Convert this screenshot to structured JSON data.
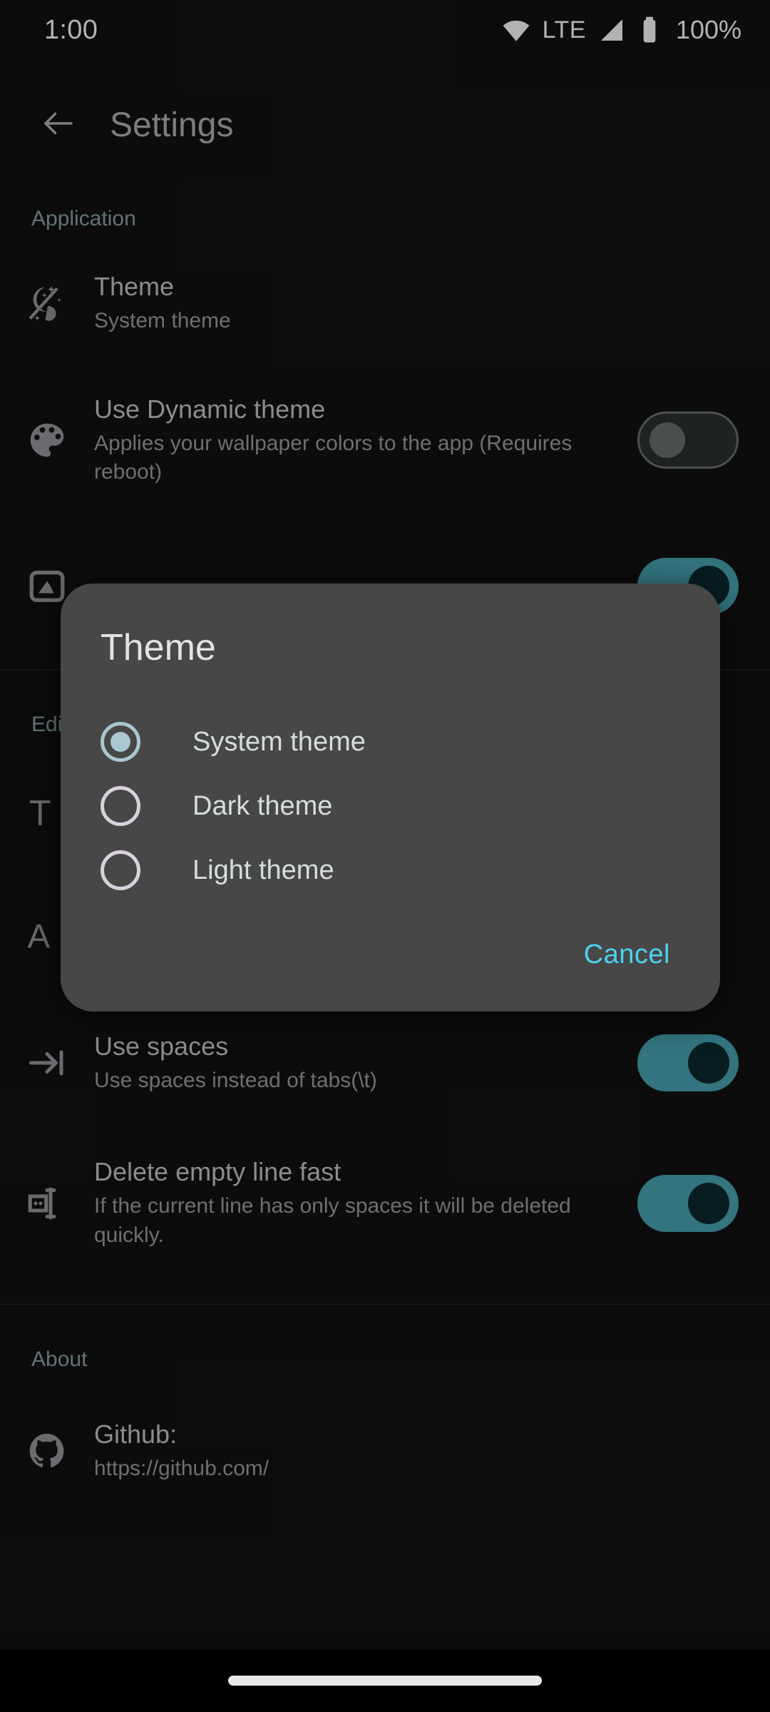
{
  "statusbar": {
    "time": "1:00",
    "network_label": "LTE",
    "battery_percent": "100%",
    "wifi_icon": "wifi-icon",
    "signal_icon": "cell-signal-icon",
    "battery_icon": "battery-full-icon"
  },
  "appbar": {
    "back_icon": "arrow-back-icon",
    "title": "Settings"
  },
  "sections": {
    "application": "Application",
    "editor": "Editor",
    "about": "About"
  },
  "prefs": {
    "theme": {
      "icon": "night-mode-icon",
      "title": "Theme",
      "summary": "System theme"
    },
    "dynamic_theme": {
      "icon": "palette-icon",
      "title": "Use Dynamic theme",
      "summary": "Applies your wallpaper colors to the app (Requires reboot)",
      "toggle_state": "off"
    },
    "hidden_image": {
      "icon": "image-icon"
    },
    "text_size": {
      "icon": "text-size-icon"
    },
    "font": {
      "icon": "font-icon"
    },
    "use_spaces": {
      "icon": "tab-arrow-icon",
      "title": "Use spaces",
      "summary": "Use spaces instead of tabs(\\t)",
      "toggle_state": "on"
    },
    "delete_empty_line": {
      "icon": "line-delete-icon",
      "title": "Delete empty line fast",
      "summary": "If the current line has only spaces it will be deleted quickly.",
      "toggle_state": "on"
    },
    "github": {
      "icon": "github-icon",
      "title": "Github:",
      "summary": "https://github.com/"
    }
  },
  "dialog": {
    "title": "Theme",
    "options": [
      {
        "label": "System theme",
        "checked": true
      },
      {
        "label": "Dark theme",
        "checked": false
      },
      {
        "label": "Light theme",
        "checked": false
      }
    ],
    "cancel_label": "Cancel"
  },
  "navbar": {
    "pill": "home-gesture-pill"
  },
  "colors": {
    "background": "#121212",
    "accent_teal": "#4aa7b5",
    "accent_cyan": "#4ad3ef",
    "section_header": "#8fa5a8",
    "dialog_bg": "#474747",
    "radio_selected": "#a9c6d1",
    "radio_unselected": "#d9d2dd"
  }
}
